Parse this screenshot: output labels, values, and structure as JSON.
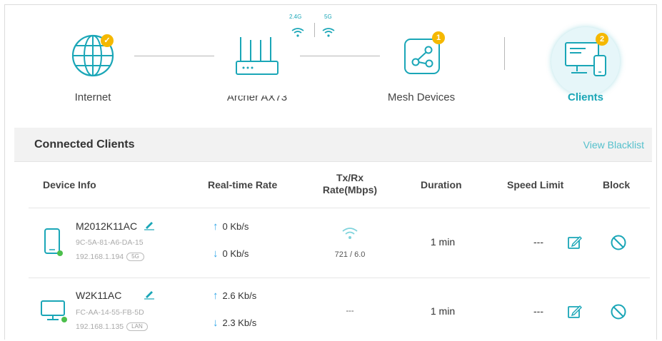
{
  "topology": {
    "internet_label": "Internet",
    "router_label": "Archer AX73",
    "band_24": "2.4G",
    "band_5": "5G",
    "mesh_label": "Mesh Devices",
    "mesh_count": "1",
    "clients_label": "Clients",
    "clients_count": "2"
  },
  "panel": {
    "title": "Connected Clients",
    "blacklist_link": "View Blacklist",
    "columns": {
      "device": "Device Info",
      "rate": "Real-time Rate",
      "txrx_line1": "Tx/Rx",
      "txrx_line2": "Rate(Mbps)",
      "duration": "Duration",
      "speed_limit": "Speed Limit",
      "block": "Block"
    },
    "rows": [
      {
        "name": "M2012K11AC",
        "mac": "9C-5A-81-A6-DA-15",
        "ip": "192.168.1.194",
        "band": "5G",
        "up": "0 Kb/s",
        "down": "0 Kb/s",
        "txrx": "721 / 6.0",
        "duration": "1 min",
        "speed_limit": "---"
      },
      {
        "name": "W2K11AC",
        "mac": "FC-AA-14-55-FB-5D",
        "ip": "192.168.1.135",
        "band": "LAN",
        "up": "2.6 Kb/s",
        "down": "2.3 Kb/s",
        "txrx": "---",
        "duration": "1 min",
        "speed_limit": "---"
      }
    ]
  },
  "colors": {
    "accent": "#2fa4e7",
    "teal": "#1aa6b7",
    "badge": "#f5b800",
    "online_dot": "#4cbf4c"
  }
}
